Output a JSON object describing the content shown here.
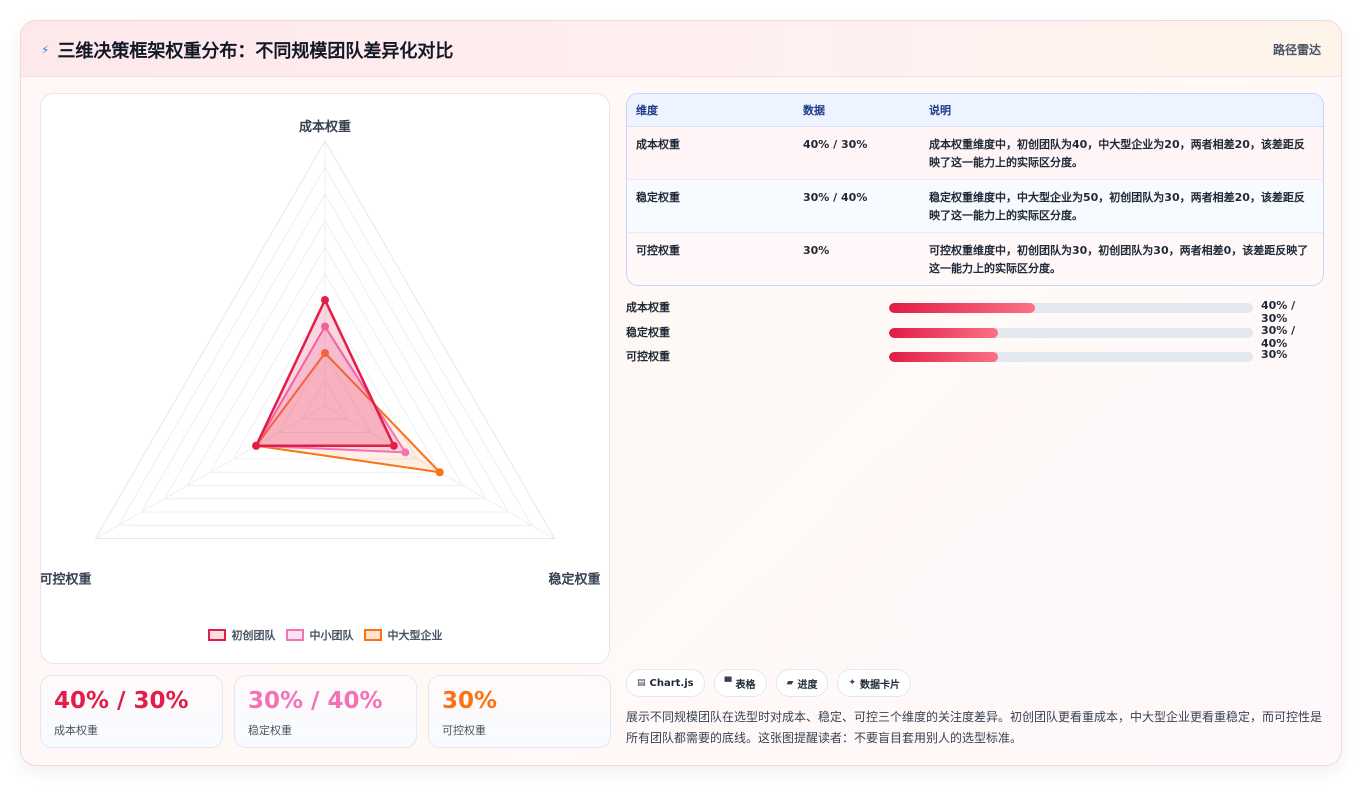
{
  "header": {
    "icon": "bolt-icon",
    "title": "三维决策框架权重分布：不同规模团队差异化对比",
    "link": "路径雷达"
  },
  "colors": {
    "startup": "#e11d48",
    "sme": "#f472b6",
    "enterprise": "#f97316"
  },
  "chart_data": {
    "type": "radar",
    "axes": [
      "成本权重",
      "稳定权重",
      "可控权重"
    ],
    "range": [
      0,
      100
    ],
    "series": [
      {
        "name": "初创团队",
        "values": [
          40,
          30,
          30
        ]
      },
      {
        "name": "中小团队",
        "values": [
          30,
          35,
          30
        ]
      },
      {
        "name": "中大型企业",
        "values": [
          20,
          50,
          30
        ]
      }
    ],
    "legend": "bottom"
  },
  "stats": [
    {
      "value": "40% / 30%",
      "label": "成本权重"
    },
    {
      "value": "30% / 40%",
      "label": "稳定权重"
    },
    {
      "value": "30%",
      "label": "可控权重"
    }
  ],
  "table": {
    "headers": [
      "维度",
      "数据",
      "说明"
    ],
    "rows": [
      [
        "成本权重",
        "40% / 30%",
        "成本权重维度中，初创团队为40，中大型企业为20，两者相差20，该差距反映了这一能力上的实际区分度。"
      ],
      [
        "稳定权重",
        "30% / 40%",
        "稳定权重维度中，中大型企业为50，初创团队为30，两者相差20，该差距反映了这一能力上的实际区分度。"
      ],
      [
        "可控权重",
        "30%",
        "可控权重维度中，初创团队为30，初创团队为30，两者相差0，该差距反映了这一能力上的实际区分度。"
      ]
    ]
  },
  "progress": [
    {
      "label": "成本权重",
      "value": "40% / 30%",
      "percent": 40
    },
    {
      "label": "稳定权重",
      "value": "30% / 40%",
      "percent": 30
    },
    {
      "label": "可控权重",
      "value": "30%",
      "percent": 30
    }
  ],
  "tags": [
    {
      "icon": "chart-icon",
      "label": "Chart.js"
    },
    {
      "icon": "table-icon",
      "label": "表格"
    },
    {
      "icon": "progress-icon",
      "label": "进度"
    },
    {
      "icon": "sparkle-icon",
      "label": "数据卡片"
    }
  ],
  "description": "展示不同规模团队在选型时对成本、稳定、可控三个维度的关注度差异。初创团队更看重成本，中大型企业更看重稳定，而可控性是所有团队都需要的底线。这张图提醒读者：不要盲目套用别人的选型标准。"
}
